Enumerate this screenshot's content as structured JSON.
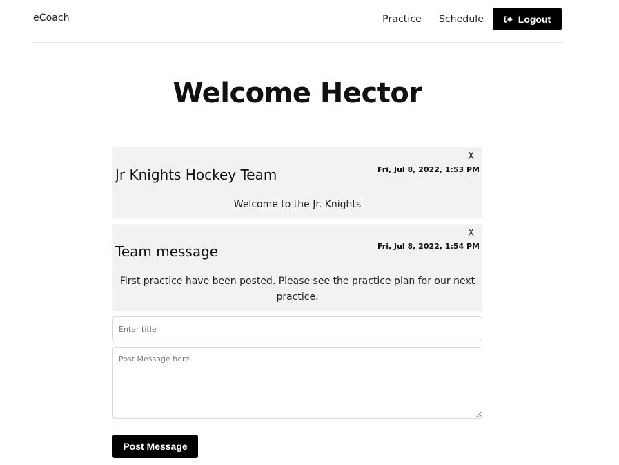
{
  "nav": {
    "brand": "eCoach",
    "links": [
      "Practice",
      "Schedule"
    ],
    "logout_label": "Logout"
  },
  "heading": "Welcome Hector",
  "posts": [
    {
      "close_label": "X",
      "date": "Fri, Jul 8, 2022, 1:53 PM",
      "title": "Jr Knights Hockey Team",
      "body": "Welcome to the Jr. Knights"
    },
    {
      "close_label": "X",
      "date": "Fri, Jul 8, 2022, 1:54 PM",
      "title": "Team message",
      "body": "First practice have been posted. Please see the practice plan for our next practice."
    }
  ],
  "form": {
    "title_placeholder": "Enter title",
    "message_placeholder": "Post Message here",
    "submit_label": "Post Message"
  },
  "colors": {
    "primary": "#000000",
    "card_background": "#f2f2f2"
  },
  "icons": {
    "logout": "sign-out-icon"
  }
}
